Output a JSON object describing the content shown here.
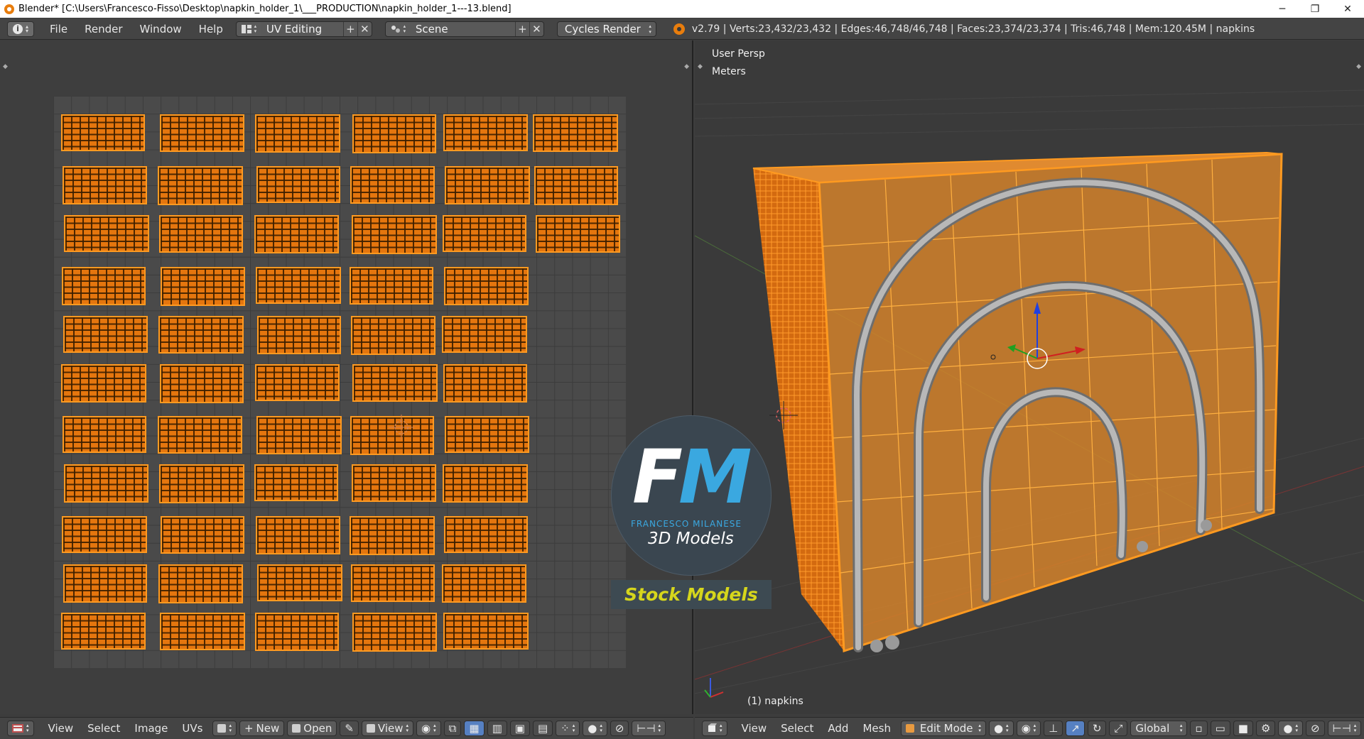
{
  "window": {
    "title": "Blender* [C:\\Users\\Francesco-Fisso\\Desktop\\napkin_holder_1\\___PRODUCTION\\napkin_holder_1---13.blend]",
    "controls": {
      "minimize": "─",
      "restore": "❐",
      "close": "✕"
    }
  },
  "info_header": {
    "editor_icon": "i",
    "menus": [
      "File",
      "Render",
      "Window",
      "Help"
    ],
    "screen_layout": "UV Editing",
    "scene": "Scene",
    "render_engine": "Cycles Render",
    "stats": "v2.79 | Verts:23,432/23,432 | Edges:46,748/46,748 | Faces:23,374/23,374 | Tris:46,748 | Mem:120.45M | napkins",
    "add_glyph": "+",
    "remove_glyph": "✕"
  },
  "uv_editor": {
    "header": {
      "menus": [
        "View",
        "Select",
        "Image",
        "UVs"
      ],
      "new_label": "New",
      "open_label": "Open",
      "view_label": "View"
    }
  },
  "viewport": {
    "view_name": "User Persp",
    "units": "Meters",
    "object_label": "(1) napkins",
    "header": {
      "menus": [
        "View",
        "Select",
        "Add",
        "Mesh"
      ],
      "mode": "Edit Mode",
      "orientation": "Global"
    }
  },
  "watermark": {
    "logo_f": "F",
    "logo_m": "M",
    "author": "FRANCESCO MILANESE",
    "subtitle": "3D Models",
    "badge": "Stock Models"
  },
  "colors": {
    "accent_orange": "#e5760e",
    "logo_blue": "#3aa8e0",
    "badge_yellow": "#d6d61c"
  }
}
